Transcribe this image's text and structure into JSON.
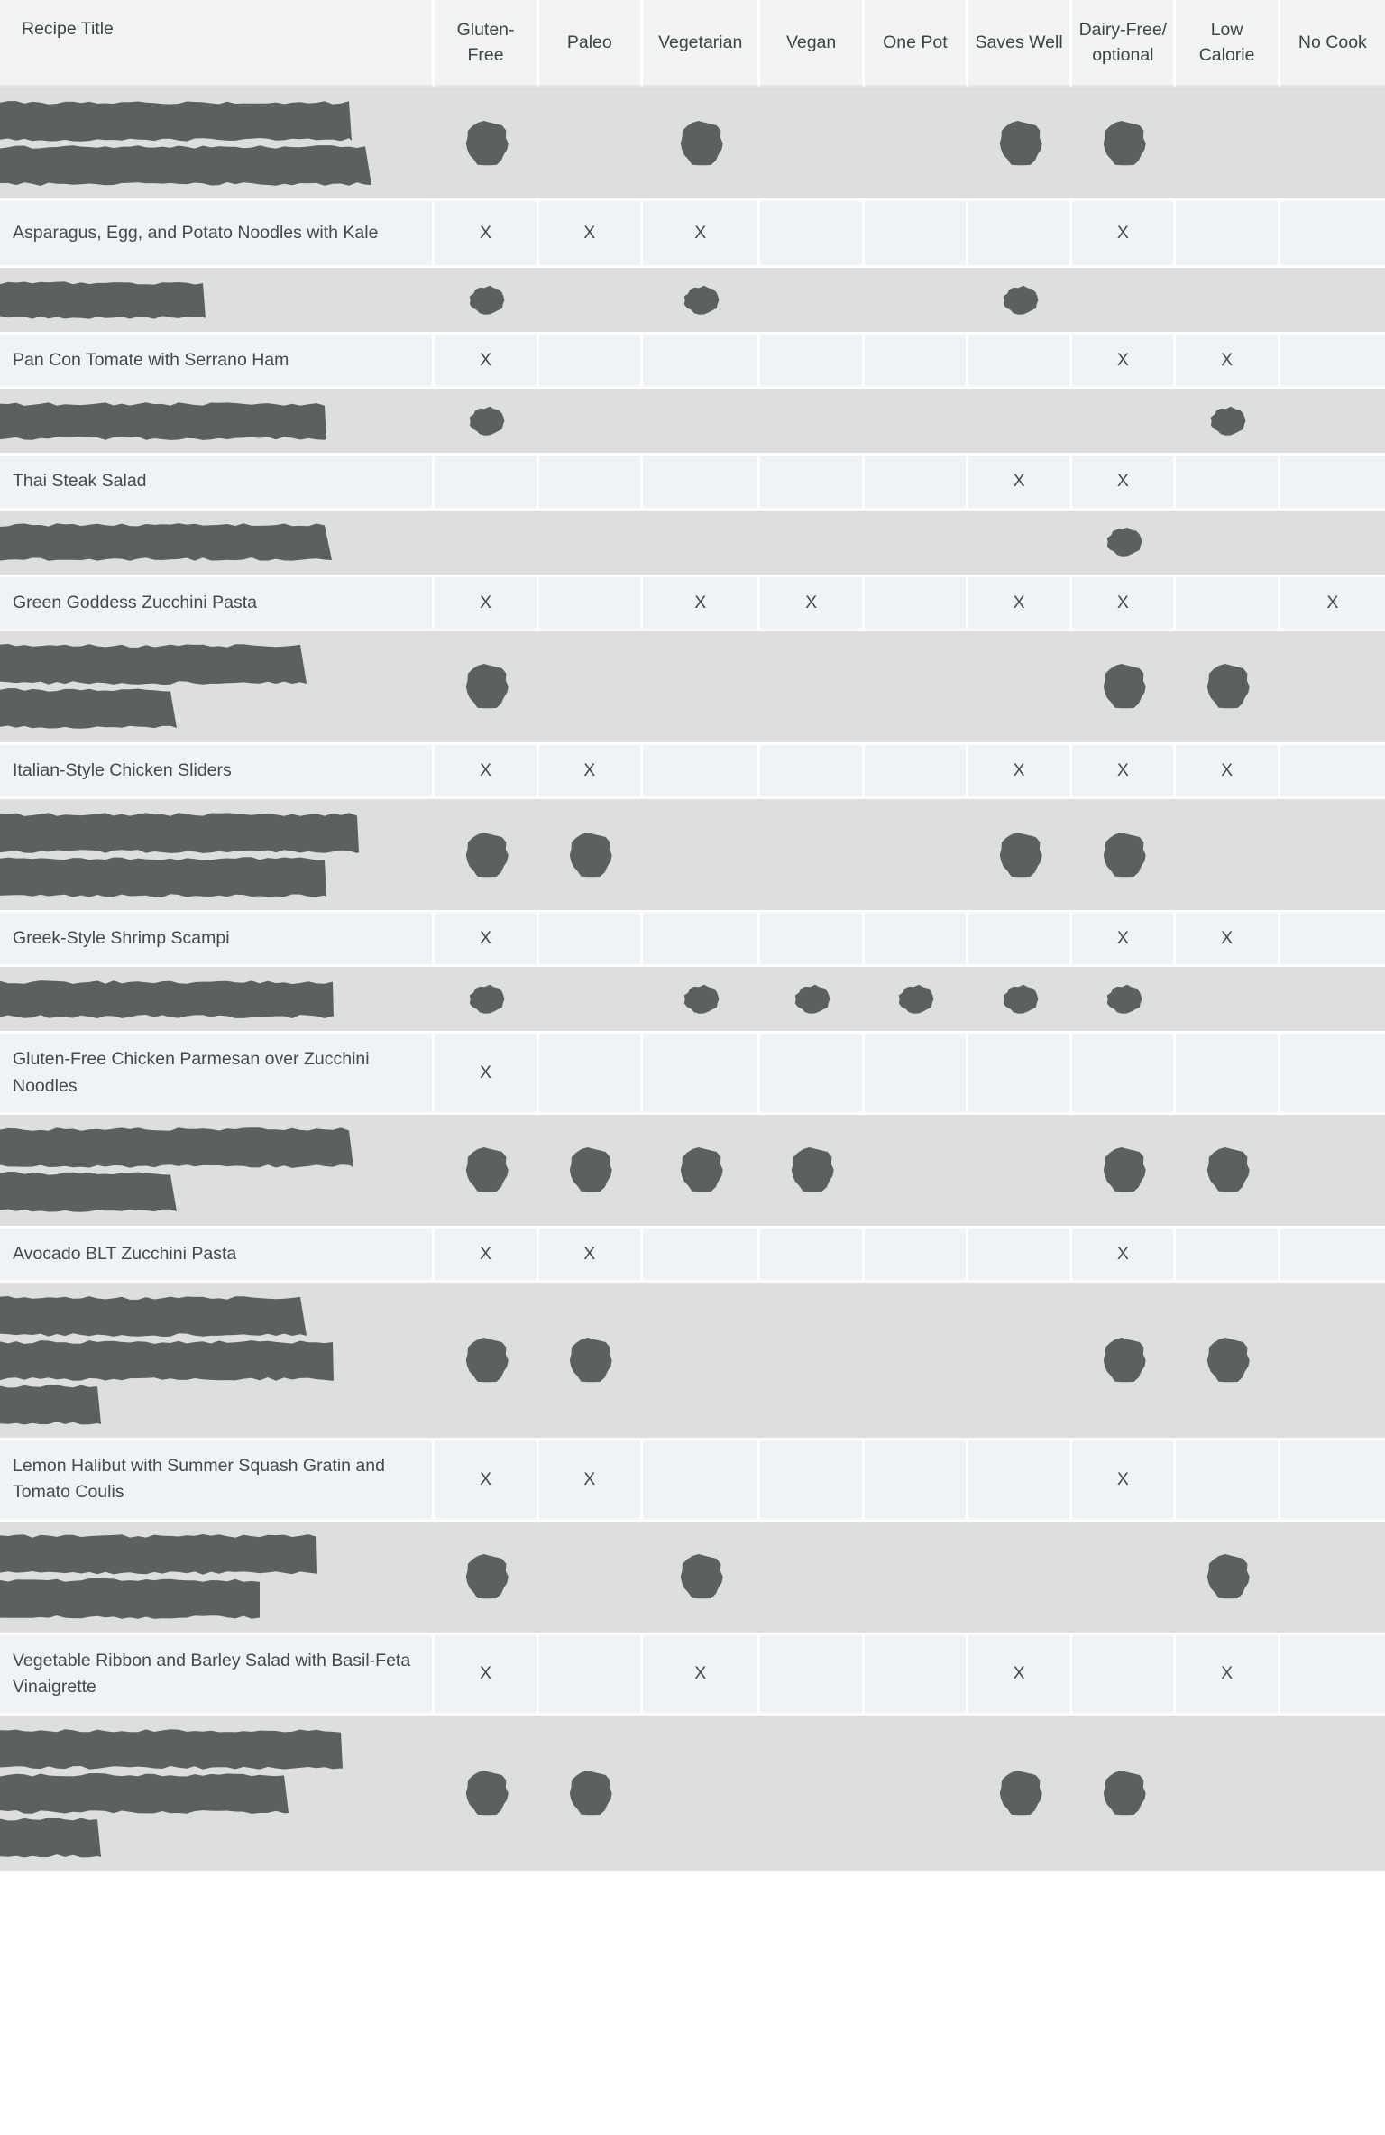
{
  "table": {
    "columns": [
      {
        "key": "title",
        "label": "Recipe Title"
      },
      {
        "key": "gluten_free",
        "label": "Gluten-Free"
      },
      {
        "key": "paleo",
        "label": "Paleo"
      },
      {
        "key": "vegetarian",
        "label": "Vegetarian"
      },
      {
        "key": "vegan",
        "label": "Vegan"
      },
      {
        "key": "one_pot",
        "label": "One Pot"
      },
      {
        "key": "saves_well",
        "label": "Saves Well"
      },
      {
        "key": "dairy_free",
        "label": "Dairy-Free/ optional"
      },
      {
        "key": "low_calorie",
        "label": "Low Calorie"
      },
      {
        "key": "no_cook",
        "label": "No Cook"
      }
    ],
    "mark": "X",
    "colors": {
      "header_bg": "#f2f3f4",
      "row_bg": "#eff3f6",
      "redacted_row_bg": "#dddfdf",
      "redaction_ink": "#5c6060",
      "text": "#45494a",
      "gap": "#ffffff"
    },
    "rows": [
      {
        "redacted": true,
        "title": "",
        "title_bar_widths": [
          390,
          412
        ],
        "marks": [
          "X",
          "",
          "X",
          "",
          "",
          "X",
          "X",
          "",
          ""
        ]
      },
      {
        "redacted": false,
        "title": "Asparagus, Egg, and Potato Noodles with Kale",
        "marks": [
          "X",
          "X",
          "X",
          "",
          "",
          "",
          "X",
          "",
          ""
        ]
      },
      {
        "redacted": true,
        "title": "",
        "title_bar_widths": [
          228
        ],
        "marks": [
          "X",
          "",
          "X",
          "",
          "",
          "X",
          "",
          "",
          ""
        ]
      },
      {
        "redacted": false,
        "title": "Pan Con Tomate with Serrano Ham",
        "marks": [
          "X",
          "",
          "",
          "",
          "",
          "",
          "X",
          "X",
          ""
        ]
      },
      {
        "redacted": true,
        "title": "",
        "title_bar_widths": [
          362
        ],
        "marks": [
          "X",
          "",
          "",
          "",
          "",
          "",
          "",
          "X",
          ""
        ]
      },
      {
        "redacted": false,
        "title": "Thai Steak Salad",
        "marks": [
          "",
          "",
          "",
          "",
          "",
          "X",
          "X",
          "",
          ""
        ]
      },
      {
        "redacted": true,
        "title": "",
        "title_bar_widths": [
          368
        ],
        "marks": [
          "",
          "",
          "",
          "",
          "",
          "",
          "X",
          "",
          ""
        ]
      },
      {
        "redacted": false,
        "title": "Green Goddess Zucchini Pasta",
        "marks": [
          "X",
          "",
          "X",
          "X",
          "",
          "X",
          "X",
          "",
          "X"
        ]
      },
      {
        "redacted": true,
        "title": "",
        "title_bar_widths": [
          340,
          196
        ],
        "marks": [
          "X",
          "",
          "",
          "",
          "",
          "",
          "X",
          "X",
          ""
        ]
      },
      {
        "redacted": false,
        "title": "Italian-Style Chicken Sliders",
        "marks": [
          "X",
          "X",
          "",
          "",
          "",
          "X",
          "X",
          "X",
          ""
        ]
      },
      {
        "redacted": true,
        "title": "",
        "title_bar_widths": [
          398,
          362
        ],
        "marks": [
          "X",
          "X",
          "",
          "",
          "",
          "X",
          "X",
          "",
          ""
        ]
      },
      {
        "redacted": false,
        "title": "Greek-Style Shrimp Scampi",
        "marks": [
          "X",
          "",
          "",
          "",
          "",
          "",
          "X",
          "X",
          ""
        ]
      },
      {
        "redacted": true,
        "title": "",
        "title_bar_widths": [
          370
        ],
        "marks": [
          "X",
          "",
          "X",
          "X",
          "X",
          "X",
          "X",
          "",
          ""
        ]
      },
      {
        "redacted": false,
        "title": "Gluten-Free Chicken Parmesan over Zucchini Noodles",
        "marks": [
          "X",
          "",
          "",
          "",
          "",
          "",
          "",
          "",
          ""
        ]
      },
      {
        "redacted": true,
        "title": "",
        "title_bar_widths": [
          392,
          196
        ],
        "marks": [
          "X",
          "X",
          "X",
          "X",
          "",
          "",
          "X",
          "X",
          ""
        ]
      },
      {
        "redacted": false,
        "title": "Avocado BLT Zucchini Pasta",
        "marks": [
          "X",
          "X",
          "",
          "",
          "",
          "",
          "X",
          "",
          ""
        ]
      },
      {
        "redacted": true,
        "title": "",
        "title_bar_widths": [
          340,
          370,
          112
        ],
        "marks": [
          "X",
          "X",
          "",
          "",
          "",
          "",
          "X",
          "X",
          ""
        ]
      },
      {
        "redacted": false,
        "title": "Lemon Halibut with Summer Squash Gratin and Tomato Coulis",
        "marks": [
          "X",
          "X",
          "",
          "",
          "",
          "",
          "X",
          "",
          ""
        ]
      },
      {
        "redacted": true,
        "title": "",
        "title_bar_widths": [
          352,
          288
        ],
        "marks": [
          "X",
          "",
          "X",
          "",
          "",
          "",
          "",
          "X",
          ""
        ]
      },
      {
        "redacted": false,
        "title": "Vegetable Ribbon and Barley Salad with Basil-Feta Vinaigrette",
        "marks": [
          "X",
          "",
          "X",
          "",
          "",
          "X",
          "",
          "X",
          ""
        ]
      },
      {
        "redacted": true,
        "title": "",
        "title_bar_widths": [
          380,
          320,
          112
        ],
        "marks": [
          "X",
          "X",
          "",
          "",
          "",
          "X",
          "X",
          "",
          ""
        ]
      }
    ]
  }
}
